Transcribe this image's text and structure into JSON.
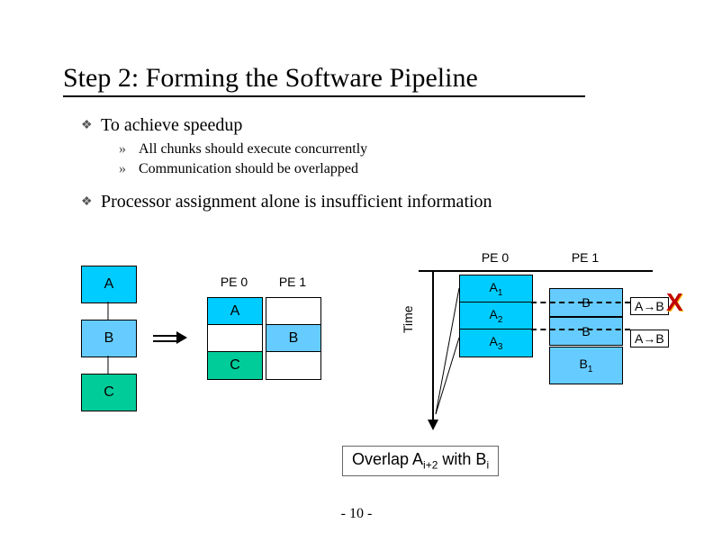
{
  "title": "Step 2: Forming the Software Pipeline",
  "bullets": {
    "marker_l1": "❖",
    "marker_l2": "»",
    "b1": "To achieve speedup",
    "b1a": "All chunks should execute concurrently",
    "b1b": "Communication should be overlapped",
    "b2": "Processor assignment alone is insufficient information"
  },
  "left": {
    "a": "A",
    "b": "B",
    "c": "C",
    "col0": "PE 0",
    "col1": "PE 1",
    "tbl_a": "A",
    "tbl_b": "B",
    "tbl_c": "C"
  },
  "timeline": {
    "time_label": "Time",
    "col0": "PE 0",
    "col1": "PE 1",
    "a1": "A<sub>1</sub>",
    "a2": "A<sub>2</sub>",
    "a3": "A<sub>3</sub>",
    "b_top": "B",
    "b_mid": "B",
    "b1": "B<sub>1</sub>",
    "ab": "A→B",
    "x": "X"
  },
  "caption_html": "Overlap A<sub>i+2</sub> with B<sub>i</sub>",
  "footer": "- 10 -"
}
